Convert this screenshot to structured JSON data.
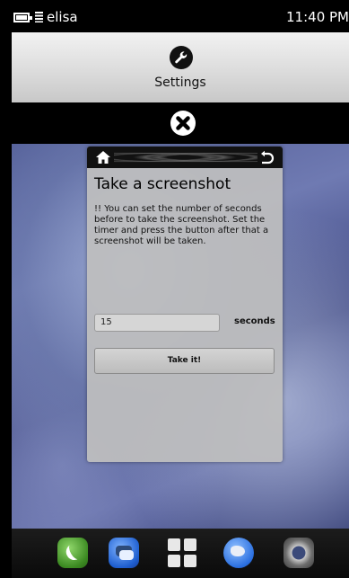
{
  "status_bar": {
    "carrier": "elisa",
    "time": "11:40 PM",
    "icons": [
      "battery-icon",
      "signal-icon"
    ]
  },
  "header": {
    "icon": "wrench-icon",
    "title": "Settings"
  },
  "close_control": {
    "icon": "close-icon"
  },
  "dialog": {
    "nav_icons": [
      "home-icon",
      "back-icon"
    ],
    "title": "Take a screenshot",
    "description": "!! You can set the number of seconds before to take the screenshot. Set the timer and press the button after that a screenshot will be taken.",
    "seconds_value": "15",
    "seconds_label": "seconds",
    "button_label": "Take it!"
  },
  "dock": {
    "items": [
      "phone-app-icon",
      "messaging-app-icon",
      "apps-grid-icon",
      "browser-app-icon",
      "camera-app-icon"
    ]
  }
}
